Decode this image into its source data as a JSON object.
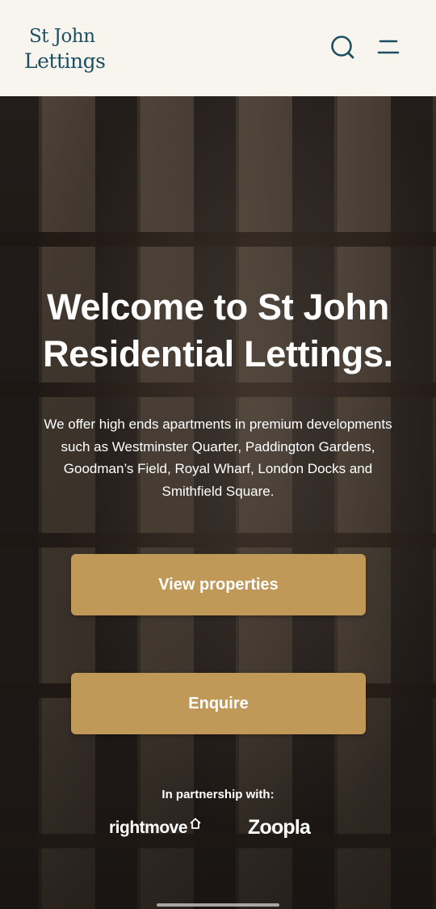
{
  "header": {
    "logo_line1": "St John",
    "logo_line2": "Lettings",
    "search_icon": "search-icon",
    "menu_icon": "menu-icon"
  },
  "hero": {
    "title": "Welcome to St John Residential Lettings.",
    "intro": "We offer high ends apartments in premium developments such as Westminster Quarter, Paddington Gardens, Goodman’s Field, Royal Wharf, London Docks and Smithfield Square.",
    "buttons": {
      "view_properties": "View properties",
      "enquire": "Enquire"
    },
    "partnership_label": "In partnership with:",
    "partners": [
      "rightmove",
      "Zoopla"
    ]
  },
  "colors": {
    "header_bg": "#f8f5ee",
    "brand": "#1d4f63",
    "button": "#c09858"
  }
}
